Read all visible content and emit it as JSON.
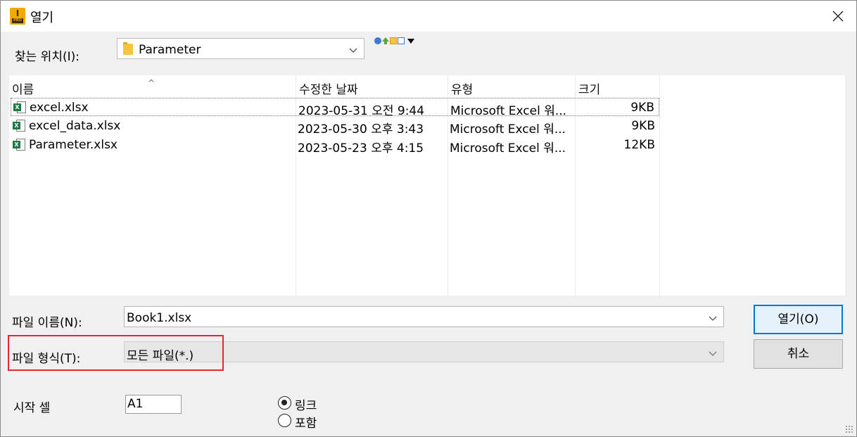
{
  "window": {
    "title": "열기",
    "app_icon_letter": "I",
    "app_icon_badge": "PRO"
  },
  "look_in": {
    "label": "찾는 위치(I):",
    "value": "Parameter"
  },
  "toolbar": {
    "icons": [
      "globe-icon",
      "up-folder-icon",
      "new-folder-icon",
      "view-menu-icon",
      "dropdown-arrow-icon"
    ]
  },
  "file_list": {
    "sort_indicator": "^",
    "columns": [
      "이름",
      "수정한 날짜",
      "유형",
      "크기"
    ],
    "rows": [
      {
        "name": "excel.xlsx",
        "modified": "2023-05-31 오전 9:44",
        "type": "Microsoft Excel 워...",
        "size": "9KB",
        "icon": "excel-file-icon"
      },
      {
        "name": "excel_data.xlsx",
        "modified": "2023-05-30 오후 3:43",
        "type": "Microsoft Excel 워...",
        "size": "9KB",
        "icon": "excel-file-icon"
      },
      {
        "name": "Parameter.xlsx",
        "modified": "2023-05-23 오후 4:15",
        "type": "Microsoft Excel 워...",
        "size": "12KB",
        "icon": "excel-file-icon"
      }
    ]
  },
  "file_name": {
    "label": "파일 이름(N):",
    "value": "Book1.xlsx"
  },
  "file_type": {
    "label": "파일 형식(T):",
    "value": "모든 파일(*.)"
  },
  "buttons": {
    "open": "열기(O)",
    "cancel": "취소"
  },
  "start_cell": {
    "label": "시작 셀",
    "value": "A1"
  },
  "options": {
    "link": "링크",
    "include": "포함",
    "selected": "link"
  },
  "colors": {
    "highlight": "#e8262f",
    "excel": "#1d7a42",
    "accent": "#0078d7"
  }
}
